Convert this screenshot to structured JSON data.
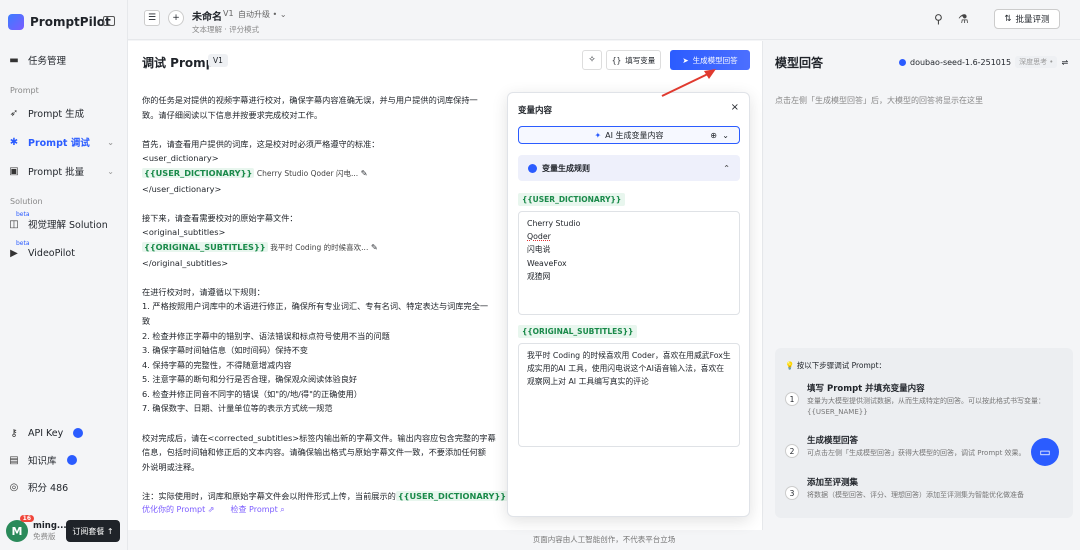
{
  "app": {
    "name": "PromptPilot"
  },
  "sidebar": {
    "items": [
      {
        "label": "任务管理",
        "icon": "briefcase-icon"
      },
      {
        "label": "Prompt 生成",
        "icon": "rocket-icon"
      },
      {
        "label": "Prompt 调试",
        "icon": "bug-icon"
      },
      {
        "label": "Prompt 批量",
        "icon": "batch-icon"
      },
      {
        "label": "视觉理解 Solution",
        "icon": "vision-icon",
        "beta": "beta"
      },
      {
        "label": "VideoPilot",
        "icon": "video-icon",
        "beta": "beta"
      },
      {
        "label": "API Key",
        "icon": "key-icon"
      },
      {
        "label": "知识库",
        "icon": "book-icon"
      },
      {
        "label": "积分 486",
        "icon": "coin-icon"
      }
    ],
    "section_prompt": "Prompt",
    "section_solution": "Solution",
    "user": {
      "initial": "M",
      "name": "ming...",
      "plan": "免费版",
      "count": "16"
    },
    "subscribe": "订阅套餐 ↑"
  },
  "topbar": {
    "title": "未命名",
    "version": "V1",
    "auto": "自动升级 •",
    "subtitle": "文本理解 · 评分模式",
    "batch": "批量评测"
  },
  "main": {
    "title": "调试 Prompt",
    "version": "V1",
    "fill_vars": "填写变量",
    "generate": "生成模型回答",
    "prompt_lines": [
      "你的任务是对提供的视频字幕进行校对，确保字幕内容准确无误，并与用户提供的词库保持一",
      "致。请仔细阅读以下信息并按要求完成校对工作。",
      "",
      "首先，请查看用户提供的词库，这是校对时必须严格遵守的标准：",
      "<user_dictionary>"
    ],
    "var1": "{{USER_DICTIONARY}}",
    "var1_val": "Cherry Studio Qoder 闪电...",
    "line_close1": "</user_dictionary>",
    "prompt_lines2": [
      "",
      "接下来，请查看需要校对的原始字幕文件：",
      "<original_subtitles>"
    ],
    "var2": "{{ORIGINAL_SUBTITLES}}",
    "var2_val": "我平时 Coding 的时候喜欢...",
    "line_close2": "</original_subtitles>",
    "prompt_lines3": [
      "",
      "在进行校对时，请遵循以下规则：",
      "1. 严格按照用户词库中的术语进行修正，确保所有专业词汇、专有名词、特定表达与词库完全一",
      "致",
      "2. 检查并修正字幕中的错别字、语法错误和标点符号使用不当的问题",
      "3. 确保字幕时间轴信息（如时间码）保持不变",
      "4. 保持字幕的完整性，不得随意增减内容",
      "5. 注意字幕的断句和分行是否合理，确保观众阅读体验良好",
      "6. 检查并修正同音不同字的错误（如\"的/地/得\"的正确使用）",
      "7. 确保数字、日期、计量单位等的表示方式统一规范",
      "",
      "校对完成后，请在<corrected_subtitles>标签内输出新的字幕文件。输出内容应包含完整的字幕",
      "信息，包括时间轴和修正后的文本内容。请确保输出格式与原始字幕文件一致，不要添加任何额",
      "外说明或注释。",
      ""
    ],
    "note": "注：实际使用时，词库和原始字幕文件会以附件形式上传，当前展示的",
    "note_var": "{{USER_DICTIONARY}}",
    "optimize": "优化你的 Prompt ⇗",
    "check": "检查 Prompt ⌕"
  },
  "popup": {
    "title": "变量内容",
    "ai_gen": "AI 生成变量内容",
    "rules": "变量生成规则",
    "var1": "{{USER_DICTIONARY}}",
    "var1_lines": [
      "Cherry Studio",
      "Qoder",
      "闪电说",
      "WeaveFox",
      "观猹网"
    ],
    "var2": "{{ORIGINAL_SUBTITLES}}",
    "var2_lines": [
      "我平时 Coding 的时候喜欢用 Coder，喜欢在用威武Fox生",
      "成实用的AI 工具，使用闪电说这个AI语音输入法，喜欢在",
      "观察网上对 AI 工具编写真实的评论"
    ]
  },
  "right": {
    "title": "模型回答",
    "model": "doubao-seed-1.6-251015",
    "deep": "深度思考 •",
    "hint": "点击左侧「生成模型回答」后，大模型的回答将显示在这里",
    "steps_header": "💡 按以下步骤调试 Prompt：",
    "steps": [
      {
        "n": "1",
        "t": "填写 Prompt 并填充变量内容",
        "d": "变量为大模型提供测试数据，从而生成特定的回答。可以按此格式书写变量：{{USER_NAME}}"
      },
      {
        "n": "2",
        "t": "生成模型回答",
        "d": "可点击左侧「生成模型回答」获得大模型的回答，调试 Prompt 效果。"
      },
      {
        "n": "3",
        "t": "添加至评测集",
        "d": "将数据（模型回答、评分、理想回答）添加至评测集为智能优化做准备"
      }
    ]
  },
  "footer": "页面内容由人工智能创作，不代表平台立场"
}
